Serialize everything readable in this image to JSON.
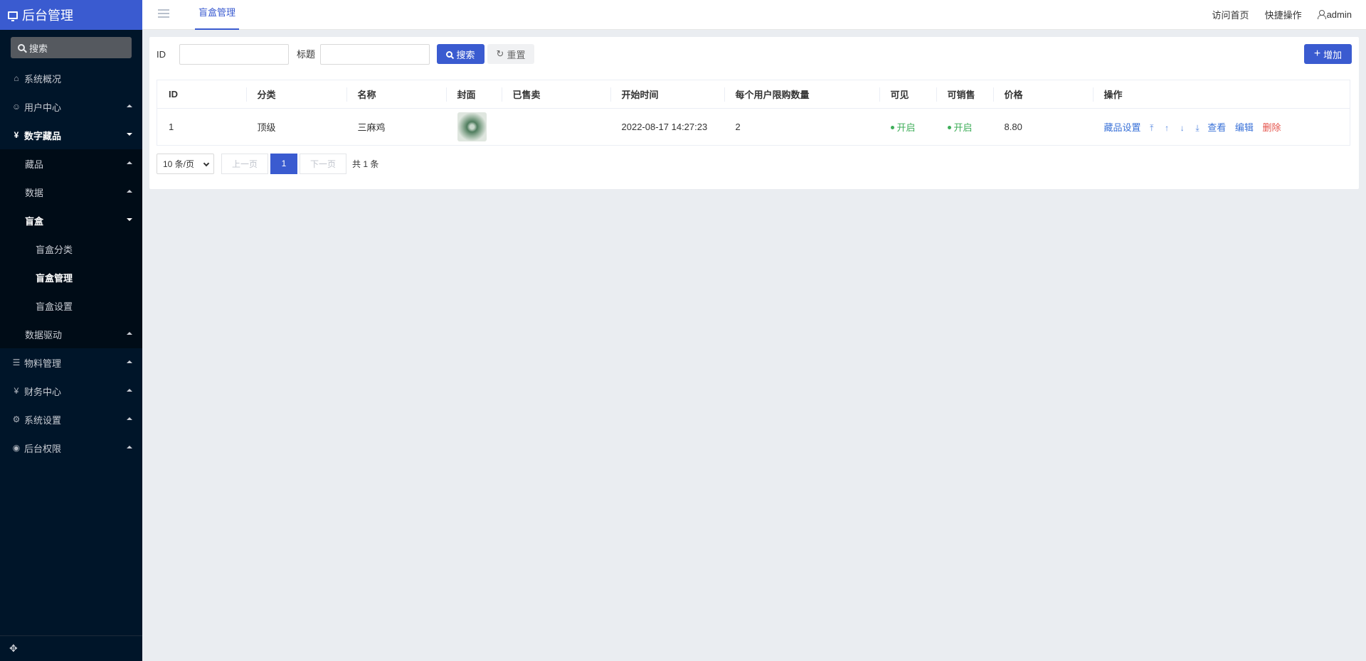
{
  "brand": {
    "title": "后台管理"
  },
  "sidebar": {
    "search_placeholder": "搜索",
    "items": [
      {
        "label": "系统概况",
        "icon": "home-icon"
      },
      {
        "label": "用户中心",
        "icon": "users-icon"
      },
      {
        "label": "数字藏品",
        "icon": "yen-icon"
      },
      {
        "label": "藏品"
      },
      {
        "label": "数据"
      },
      {
        "label": "盲盒"
      },
      {
        "label": "盲盒分类"
      },
      {
        "label": "盲盒管理"
      },
      {
        "label": "盲盒设置"
      },
      {
        "label": "数据驱动"
      },
      {
        "label": "物料管理",
        "icon": "list-icon"
      },
      {
        "label": "财务中心",
        "icon": "yen-icon"
      },
      {
        "label": "系统设置",
        "icon": "gear-icon"
      },
      {
        "label": "后台权限",
        "icon": "user-circle-icon"
      }
    ],
    "footer_icon": "move-icon"
  },
  "header": {
    "active_tab": "盲盒管理",
    "links": [
      "访问首页",
      "快捷操作"
    ],
    "user": "admin"
  },
  "filter": {
    "id_label": "ID",
    "title_label": "标题",
    "search_button": "搜索",
    "reset_button": "重置",
    "add_button": "增加"
  },
  "table": {
    "columns": [
      "ID",
      "分类",
      "名称",
      "封面",
      "已售卖",
      "开始时间",
      "每个用户限购数量",
      "可见",
      "可销售",
      "价格",
      "操作"
    ],
    "rows": [
      {
        "id": "1",
        "category": "顶级",
        "name": "三麻鸡",
        "sold": "",
        "start_time": "2022-08-17 14:27:23",
        "limit": "2",
        "visible": "开启",
        "saleable": "开启",
        "price": "8.80",
        "ops": {
          "settings": "藏品设置",
          "view": "查看",
          "edit": "编辑",
          "delete": "删除"
        }
      }
    ]
  },
  "pager": {
    "page_size": "10 条/页",
    "prev": "上一页",
    "current": "1",
    "next": "下一页",
    "total": "共 1 条"
  },
  "colors": {
    "primary": "#3a5bd0",
    "sidebar_bg": "#001529",
    "success": "#3fae5a",
    "danger": "#e5534b",
    "link": "#3a72d8"
  }
}
